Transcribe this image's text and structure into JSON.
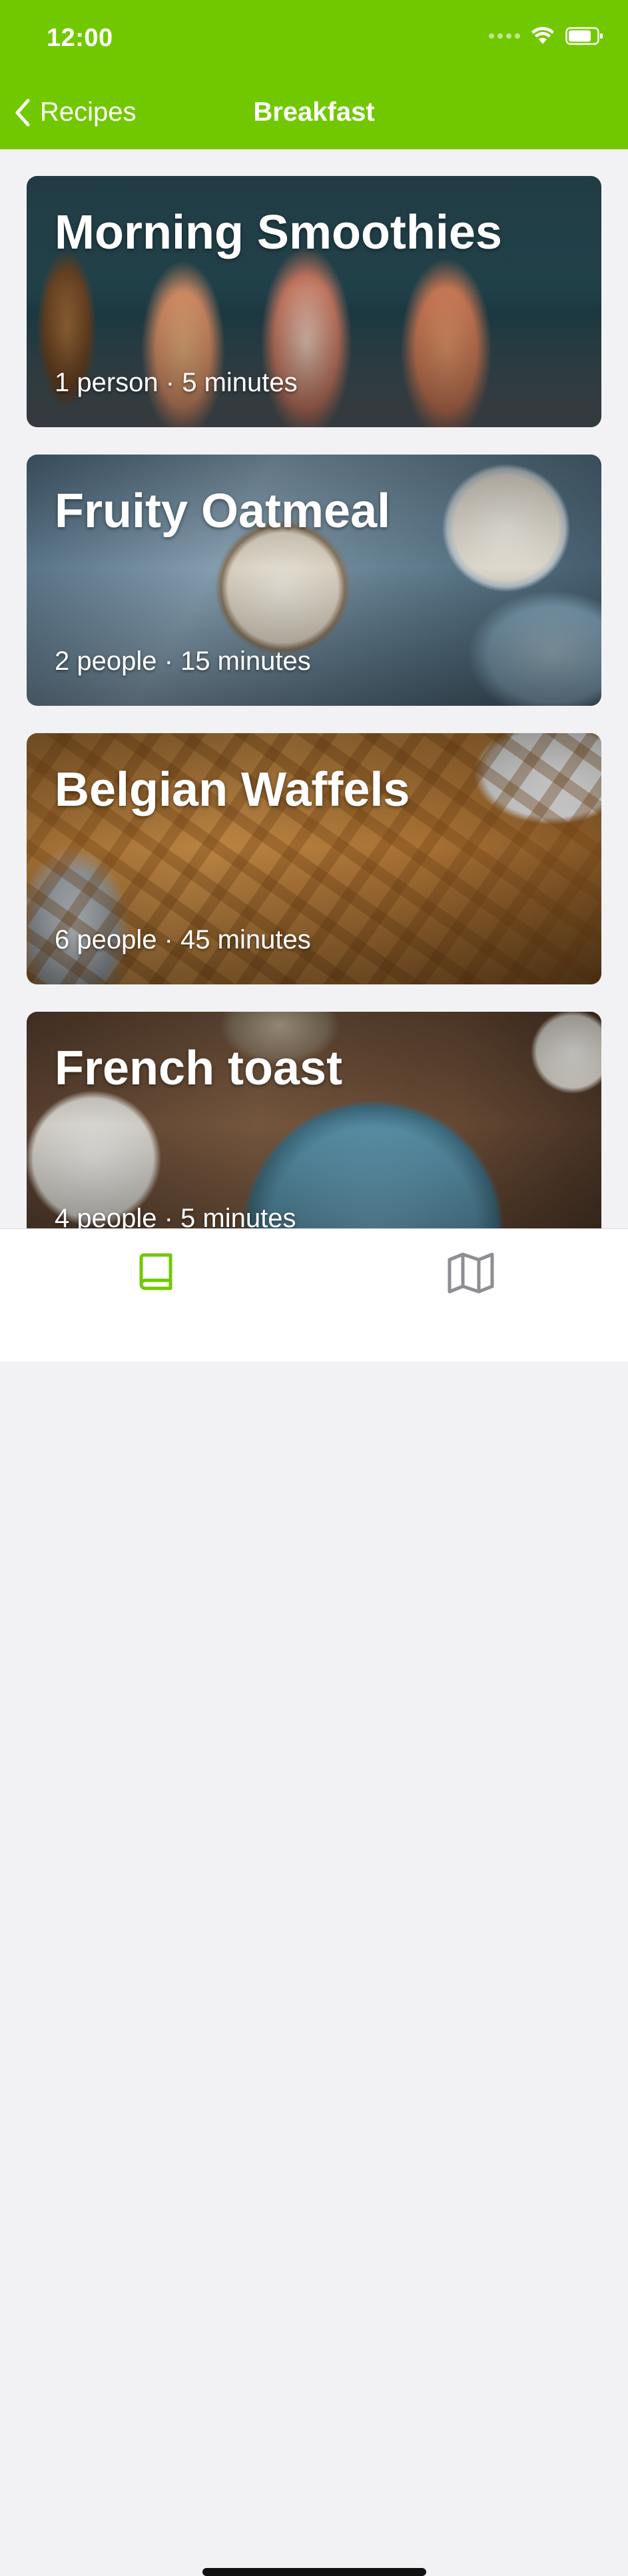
{
  "status_bar": {
    "time": "12:00"
  },
  "nav": {
    "back_label": "Recipes",
    "title": "Breakfast"
  },
  "recipes": [
    {
      "title": "Morning Smoothies",
      "meta": "1 person · 5 minutes"
    },
    {
      "title": "Fruity Oatmeal",
      "meta": "2 people · 15 minutes"
    },
    {
      "title": "Belgian Waffels",
      "meta": "6 people · 45 minutes"
    },
    {
      "title": "French toast",
      "meta": "4 people · 5 minutes"
    }
  ],
  "tabbar": {
    "tabs": [
      {
        "icon": "book-icon",
        "active": true
      },
      {
        "icon": "map-icon",
        "active": false
      }
    ]
  },
  "colors": {
    "accent": "#72c800",
    "background": "#f2f2f4",
    "inactive_icon": "#8e8e93"
  }
}
